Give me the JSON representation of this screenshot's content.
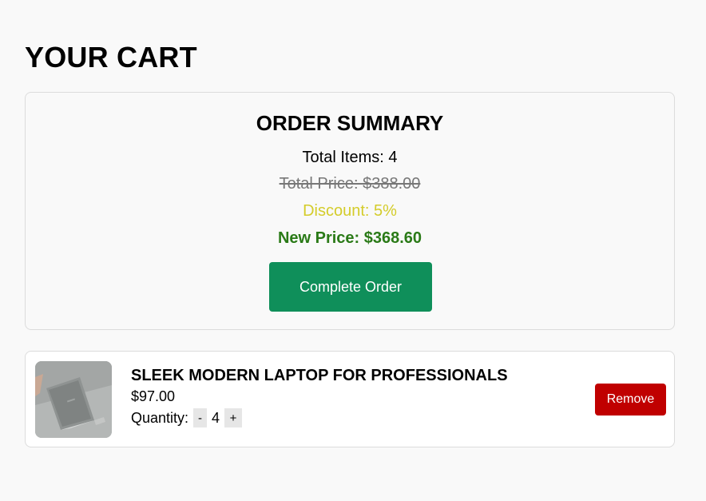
{
  "page": {
    "title": "YOUR CART"
  },
  "summary": {
    "title": "ORDER SUMMARY",
    "total_items": "Total Items: 4",
    "total_price": "Total Price: $388.00",
    "discount": "Discount: 5%",
    "new_price": "New Price: $368.60",
    "complete_button": "Complete Order",
    "colors": {
      "discount": "#d4cc2a",
      "new_price": "#2a7a17",
      "button": "#0f8f5a"
    }
  },
  "cart": {
    "items": [
      {
        "name": "SLEEK MODERN LAPTOP FOR PROFESSIONALS",
        "price": "$97.00",
        "quantity_label": "Quantity:",
        "quantity": "4",
        "decrement": "-",
        "increment": "+",
        "remove_label": "Remove",
        "image_icon": "laptop-image",
        "remove_color": "#c00000"
      }
    ]
  }
}
